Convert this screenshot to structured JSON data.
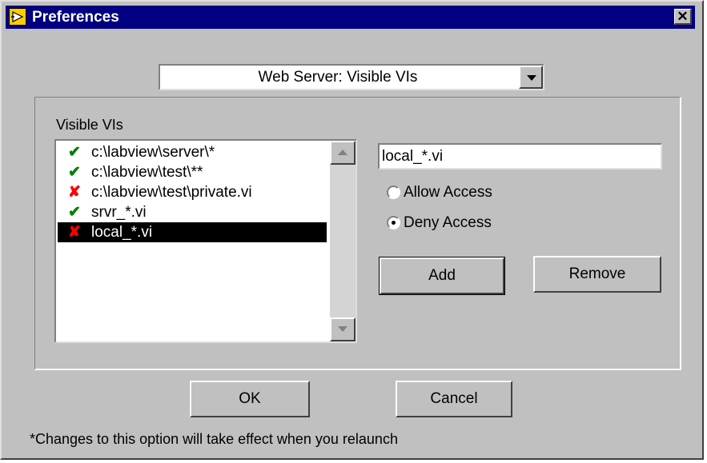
{
  "window": {
    "title": "Preferences",
    "close_label": "✕"
  },
  "category": {
    "value": "Web Server:  Visible VIs"
  },
  "visible_vis": {
    "label": "Visible VIs",
    "items": [
      {
        "mark": "✔",
        "status": "allow",
        "text": "c:\\labview\\server\\*",
        "selected": false
      },
      {
        "mark": "✔",
        "status": "allow",
        "text": "c:\\labview\\test\\**",
        "selected": false
      },
      {
        "mark": "✘",
        "status": "deny",
        "text": "c:\\labview\\test\\private.vi",
        "selected": false
      },
      {
        "mark": "✔",
        "status": "allow",
        "text": "srvr_*.vi",
        "selected": false
      },
      {
        "mark": "✘",
        "status": "deny",
        "text": "local_*.vi",
        "selected": true
      }
    ]
  },
  "pattern_input": {
    "value": "local_*.vi"
  },
  "access": {
    "allow_label": "Allow Access",
    "deny_label": "Deny Access",
    "selected": "deny"
  },
  "buttons": {
    "add": "Add",
    "remove": "Remove",
    "ok": "OK",
    "cancel": "Cancel"
  },
  "note": "*Changes to this option will take effect when you relaunch",
  "colors": {
    "title_bar": "#000080",
    "dialog_bg": "#c0c0c0",
    "allow_mark": "#008000",
    "deny_mark": "#ff0000",
    "selection": "#000000"
  }
}
